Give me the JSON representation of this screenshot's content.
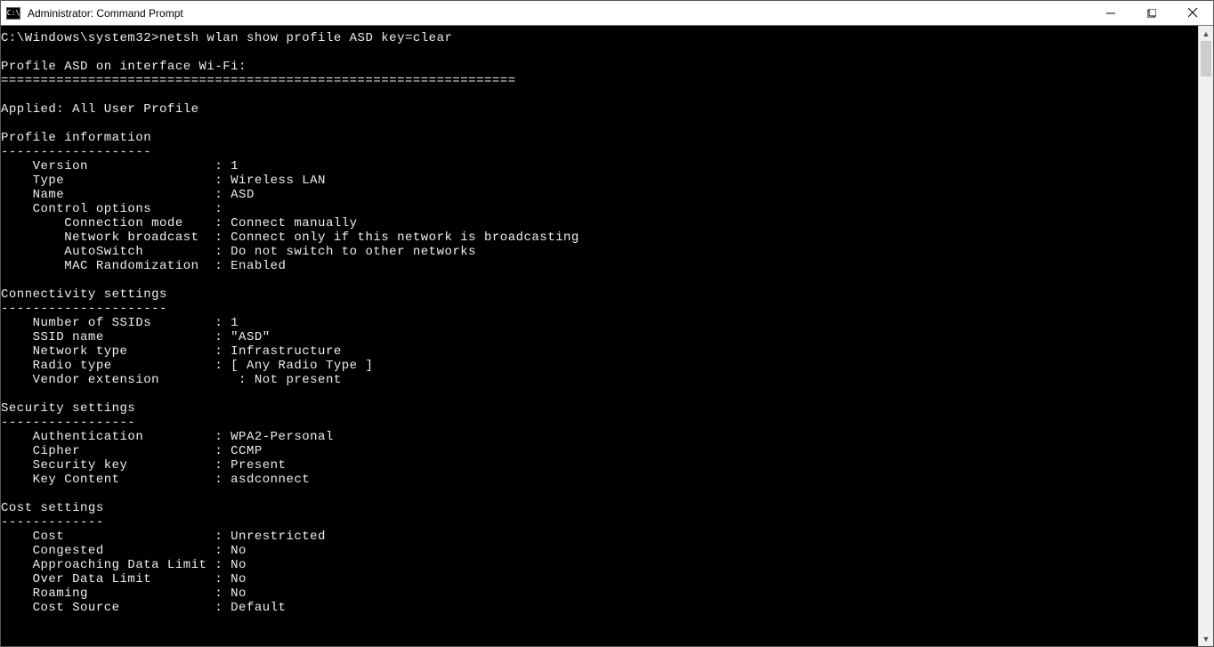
{
  "window": {
    "title": "Administrator: Command Prompt",
    "icon_text": "C:\\"
  },
  "prompt": {
    "path": "C:\\Windows\\system32>",
    "command": "netsh wlan show profile ASD key=clear"
  },
  "output": {
    "header_line": "Profile ASD on interface Wi-Fi:",
    "separator": "=================================================================",
    "applied_line": "Applied: All User Profile",
    "sections": {
      "profile_info": {
        "title": "Profile information",
        "dash": "-------------------",
        "rows": [
          {
            "label": "Version",
            "value": "1"
          },
          {
            "label": "Type",
            "value": "Wireless LAN"
          },
          {
            "label": "Name",
            "value": "ASD"
          },
          {
            "label": "Control options",
            "value": ""
          }
        ],
        "subrows": [
          {
            "label": "Connection mode",
            "value": "Connect manually"
          },
          {
            "label": "Network broadcast",
            "value": "Connect only if this network is broadcasting"
          },
          {
            "label": "AutoSwitch",
            "value": "Do not switch to other networks"
          },
          {
            "label": "MAC Randomization",
            "value": "Enabled"
          }
        ]
      },
      "connectivity": {
        "title": "Connectivity settings",
        "dash": "---------------------",
        "rows": [
          {
            "label": "Number of SSIDs",
            "value": "1"
          },
          {
            "label": "SSID name",
            "value": "\"ASD\""
          },
          {
            "label": "Network type",
            "value": "Infrastructure"
          },
          {
            "label": "Radio type",
            "value": "[ Any Radio Type ]"
          }
        ],
        "extra": {
          "label": "Vendor extension",
          "value": "Not present"
        }
      },
      "security": {
        "title": "Security settings",
        "dash": "-----------------",
        "rows": [
          {
            "label": "Authentication",
            "value": "WPA2-Personal"
          },
          {
            "label": "Cipher",
            "value": "CCMP"
          },
          {
            "label": "Security key",
            "value": "Present"
          },
          {
            "label": "Key Content",
            "value": "asdconnect"
          }
        ]
      },
      "cost": {
        "title": "Cost settings",
        "dash": "-------------",
        "rows": [
          {
            "label": "Cost",
            "value": "Unrestricted"
          },
          {
            "label": "Congested",
            "value": "No"
          },
          {
            "label": "Approaching Data Limit",
            "value": "No"
          },
          {
            "label": "Over Data Limit",
            "value": "No"
          },
          {
            "label": "Roaming",
            "value": "No"
          },
          {
            "label": "Cost Source",
            "value": "Default"
          }
        ]
      }
    }
  }
}
